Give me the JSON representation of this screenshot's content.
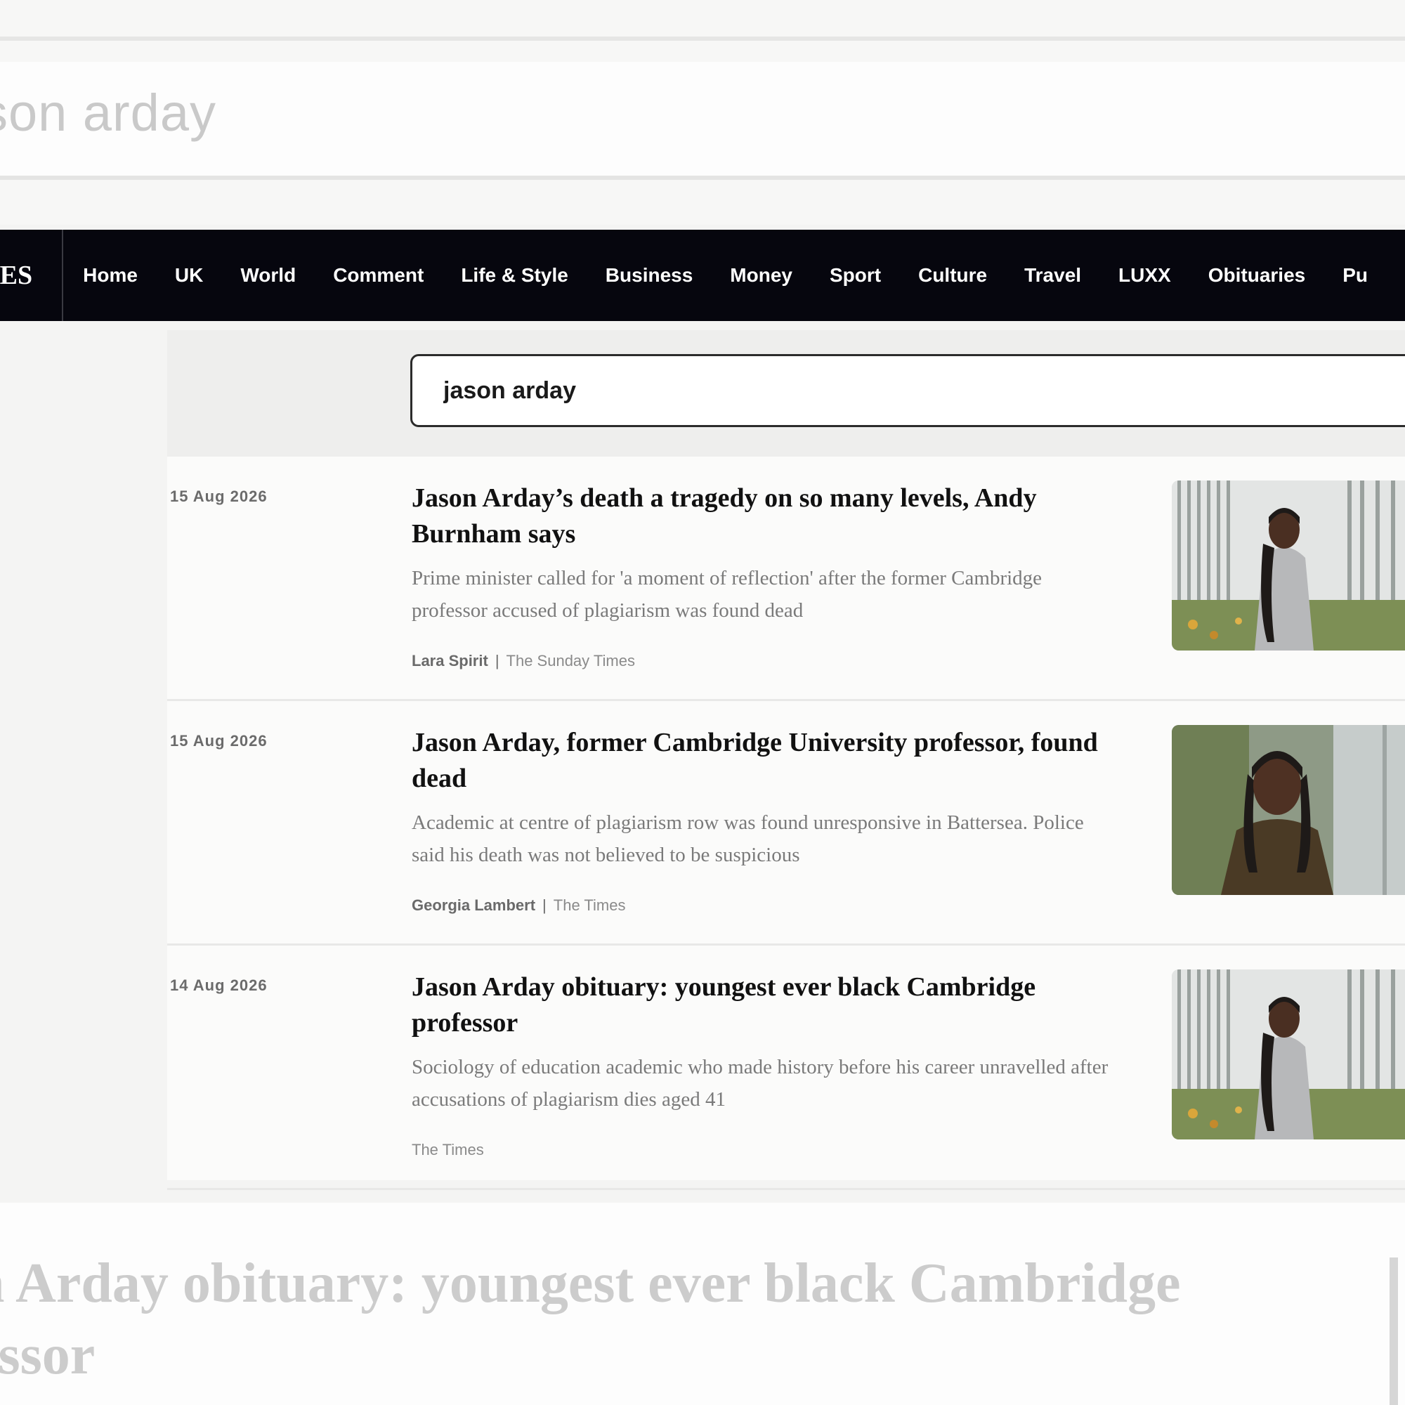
{
  "background_search": {
    "query_fragment": "son arday"
  },
  "nav": {
    "logo": "MES",
    "items": [
      "Home",
      "UK",
      "World",
      "Comment",
      "Life & Style",
      "Business",
      "Money",
      "Sport",
      "Culture",
      "Travel",
      "LUXX",
      "Obituaries",
      "Pu"
    ]
  },
  "search": {
    "value": "jason arday"
  },
  "results": [
    {
      "date": "15 Aug 2026",
      "title": "Jason Arday’s death a tragedy on so many levels, Andy Burnham says",
      "summary": "Prime minister called for 'a moment of reflection' after the former Cambridge professor accused of plagiarism was found dead",
      "author": "Lara Spirit",
      "publication": "The Sunday Times",
      "image": "portrait-photo"
    },
    {
      "date": "15 Aug 2026",
      "title": "Jason Arday, former Cambridge University professor, found dead",
      "summary": "Academic at centre of plagiarism row was found unresponsive in Battersea. Police said his death was not believed to be suspicious",
      "author": "Georgia Lambert",
      "publication": "The Times",
      "image": "portrait-photo"
    },
    {
      "date": "14 Aug 2026",
      "title": "Jason Arday obituary: youngest ever black Cambridge professor",
      "summary": "Sociology of education academic who made history before his career unravelled after accusations of plagiarism dies aged 41",
      "author": "",
      "publication": "The Times",
      "image": "portrait-photo"
    }
  ],
  "background_headline": "n Arday obituary: youngest ever black Cambridge\nessor",
  "colors": {
    "nav_background": "#06060e",
    "page_background": "#f4f4f3"
  }
}
